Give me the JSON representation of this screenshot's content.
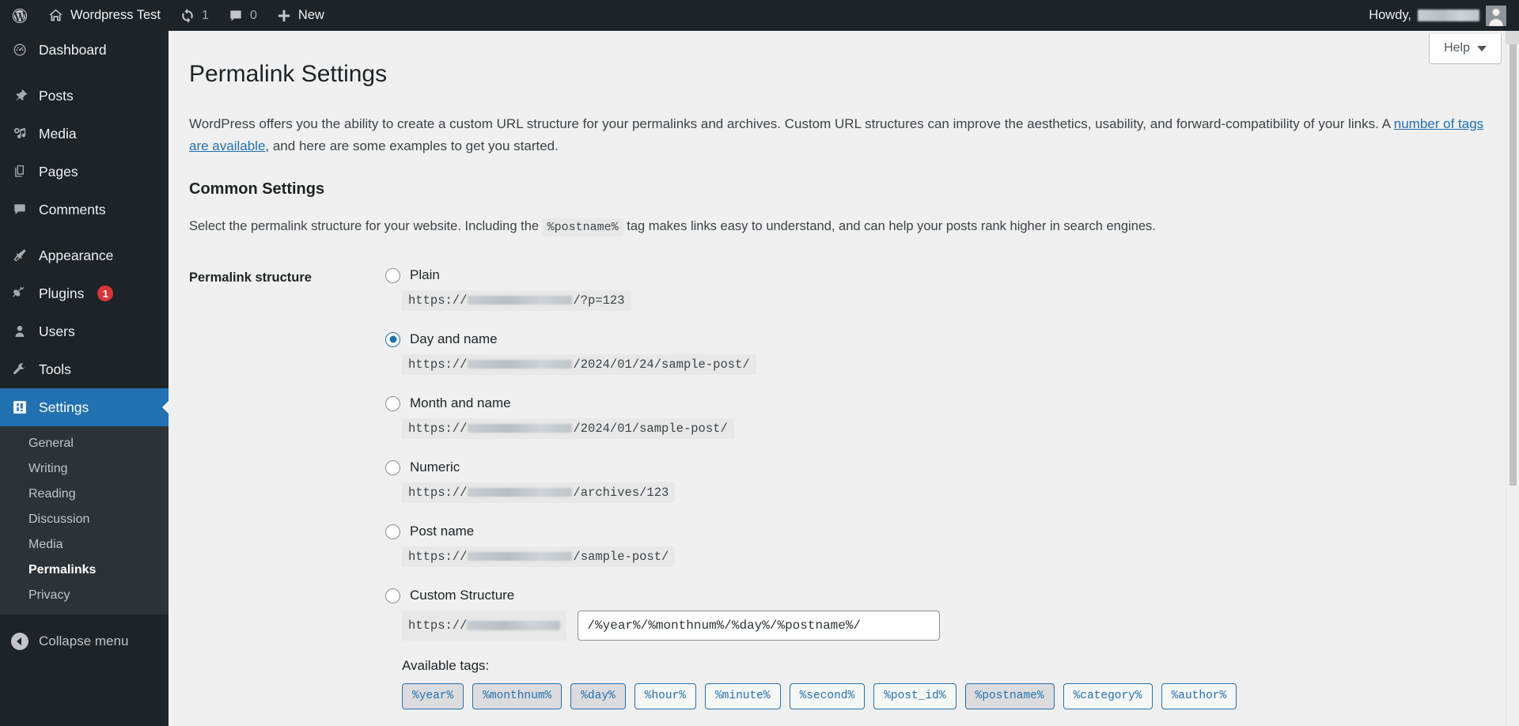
{
  "adminbar": {
    "wp_logo": "wordpress-logo",
    "site_name": "Wordpress Test",
    "updates_count": "1",
    "comments_count": "0",
    "new_label": "New",
    "howdy_label": "Howdy,",
    "username_redacted": true
  },
  "sidebar": {
    "items": [
      {
        "label": "Dashboard",
        "icon": "dashboard-icon",
        "badge": ""
      },
      {
        "label": "Posts",
        "icon": "pin-icon",
        "badge": ""
      },
      {
        "label": "Media",
        "icon": "media-icon",
        "badge": ""
      },
      {
        "label": "Pages",
        "icon": "pages-icon",
        "badge": ""
      },
      {
        "label": "Comments",
        "icon": "comments-icon",
        "badge": ""
      },
      {
        "label": "Appearance",
        "icon": "brush-icon",
        "badge": ""
      },
      {
        "label": "Plugins",
        "icon": "plug-icon",
        "badge": "1"
      },
      {
        "label": "Users",
        "icon": "user-icon",
        "badge": ""
      },
      {
        "label": "Tools",
        "icon": "wrench-icon",
        "badge": ""
      },
      {
        "label": "Settings",
        "icon": "settings-icon",
        "badge": ""
      }
    ],
    "submenu": [
      {
        "label": "General",
        "active": false
      },
      {
        "label": "Writing",
        "active": false
      },
      {
        "label": "Reading",
        "active": false
      },
      {
        "label": "Discussion",
        "active": false
      },
      {
        "label": "Media",
        "active": false
      },
      {
        "label": "Permalinks",
        "active": true
      },
      {
        "label": "Privacy",
        "active": false
      }
    ],
    "collapse_label": "Collapse menu"
  },
  "help": {
    "label": "Help"
  },
  "page": {
    "title": "Permalink Settings",
    "intro_part1": "WordPress offers you the ability to create a custom URL structure for your permalinks and archives. Custom URL structures can improve the aesthetics, usability, and forward-compatibility of your links. A ",
    "intro_link": "number of tags are available",
    "intro_part2": ", and here are some examples to get you started.",
    "section_title": "Common Settings",
    "section_desc_part1": "Select the permalink structure for your website. Including the ",
    "section_desc_code": "%postname%",
    "section_desc_part2": " tag makes links easy to understand, and can help your posts rank higher in search engines.",
    "field_label": "Permalink structure"
  },
  "permalink_options": [
    {
      "label": "Plain",
      "selected": false,
      "example_prefix": "https://",
      "example_suffix": "/?p=123",
      "redact_width": 132
    },
    {
      "label": "Day and name",
      "selected": true,
      "example_prefix": "https://",
      "example_suffix": "/2024/01/24/sample-post/",
      "redact_width": 132
    },
    {
      "label": "Month and name",
      "selected": false,
      "example_prefix": "https://",
      "example_suffix": "/2024/01/sample-post/",
      "redact_width": 132
    },
    {
      "label": "Numeric",
      "selected": false,
      "example_prefix": "https://",
      "example_suffix": "/archives/123",
      "redact_width": 132
    },
    {
      "label": "Post name",
      "selected": false,
      "example_prefix": "https://",
      "example_suffix": "/sample-post/",
      "redact_width": 132
    }
  ],
  "custom_structure": {
    "label": "Custom Structure",
    "selected": false,
    "prefix": "https://",
    "value": "/%year%/%monthnum%/%day%/%postname%/",
    "available_tags_label": "Available tags:"
  },
  "available_tags": [
    {
      "label": "%year%",
      "pressed": true
    },
    {
      "label": "%monthnum%",
      "pressed": true
    },
    {
      "label": "%day%",
      "pressed": true
    },
    {
      "label": "%hour%",
      "pressed": false
    },
    {
      "label": "%minute%",
      "pressed": false
    },
    {
      "label": "%second%",
      "pressed": false
    },
    {
      "label": "%post_id%",
      "pressed": false
    },
    {
      "label": "%postname%",
      "pressed": true
    },
    {
      "label": "%category%",
      "pressed": false
    },
    {
      "label": "%author%",
      "pressed": false
    }
  ],
  "colors": {
    "admin_dark": "#1d2327",
    "admin_submenu": "#2c3338",
    "accent_blue": "#2271b1",
    "badge_red": "#d63638",
    "page_bg": "#f0f0f1"
  }
}
